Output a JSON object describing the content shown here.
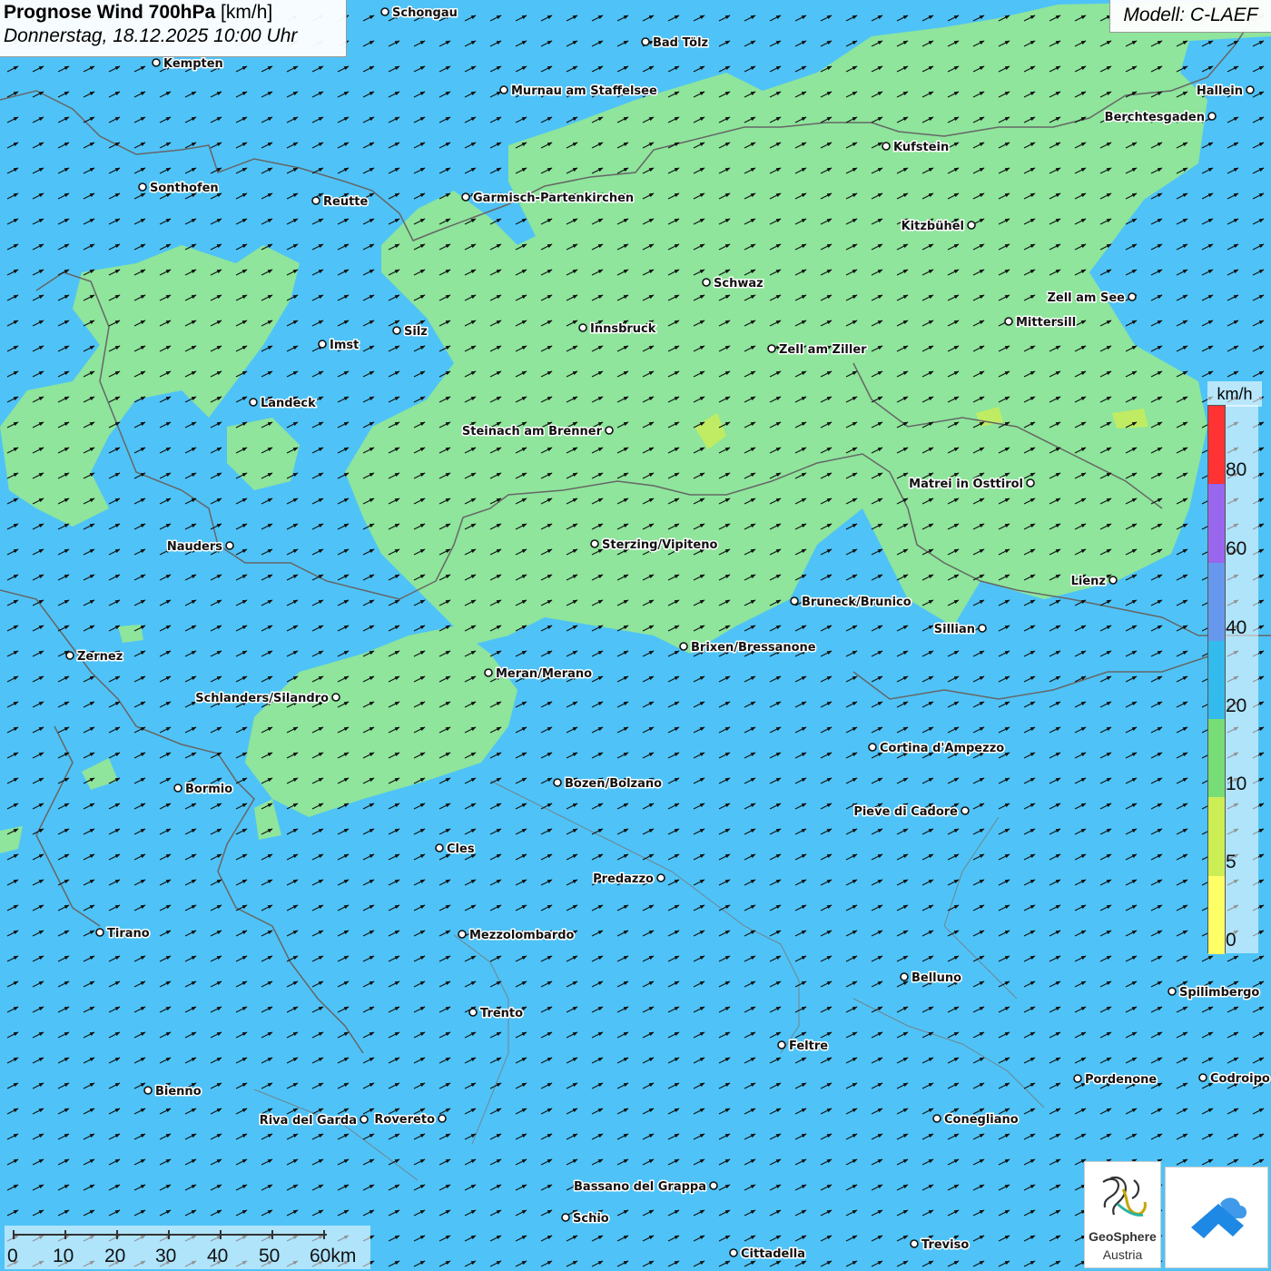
{
  "header": {
    "title_bold": "Prognose Wind 700hPa",
    "title_unit": "[km/h]",
    "datetime": "Donnerstag, 18.12.2025 10:00 Uhr"
  },
  "model_label": "Modell: C-LAEF",
  "legend": {
    "unit": "km/h",
    "labels": [
      "80",
      "60",
      "40",
      "20",
      "10",
      "5",
      "0"
    ],
    "colors": [
      "#ff3333",
      "#9966ee",
      "#6699ee",
      "#33bbee",
      "#77dd77",
      "#ccee55",
      "#ffff66"
    ]
  },
  "colors": {
    "water_blue": "#4fc3f7",
    "calm_green": "#8ee59b",
    "border_gray": "#666666"
  },
  "scalebar": {
    "labels": [
      "0",
      "10",
      "20",
      "30",
      "40",
      "50",
      "60km"
    ]
  },
  "logos": {
    "geosphere_line1": "GeoSphere",
    "geosphere_line2": "Austria"
  },
  "cities": [
    {
      "name": "Schongau"
    },
    {
      "name": "Bad Tölz"
    },
    {
      "name": "Kempten"
    },
    {
      "name": "Murnau am Staffelsee"
    },
    {
      "name": "Hallein"
    },
    {
      "name": "Berchtesgaden"
    },
    {
      "name": "Kufstein"
    },
    {
      "name": "Sonthofen"
    },
    {
      "name": "Reutte"
    },
    {
      "name": "Garmisch-Partenkirchen"
    },
    {
      "name": "Kitzbühel"
    },
    {
      "name": "Schwaz"
    },
    {
      "name": "Zell am See"
    },
    {
      "name": "Mittersill"
    },
    {
      "name": "Innsbruck"
    },
    {
      "name": "Silz"
    },
    {
      "name": "Imst"
    },
    {
      "name": "Zell am Ziller"
    },
    {
      "name": "Landeck"
    },
    {
      "name": "Steinach am Brenner"
    },
    {
      "name": "Matrei in Osttirol"
    },
    {
      "name": "Nauders"
    },
    {
      "name": "Sterzing/Vipiteno"
    },
    {
      "name": "Lienz"
    },
    {
      "name": "Bruneck/Brunico"
    },
    {
      "name": "Sillian"
    },
    {
      "name": "Zernez"
    },
    {
      "name": "Brixen/Bressanone"
    },
    {
      "name": "Meran/Merano"
    },
    {
      "name": "Schlanders/Silandro"
    },
    {
      "name": "Cortina d'Ampezzo"
    },
    {
      "name": "Bozen/Bolzano"
    },
    {
      "name": "Bormio"
    },
    {
      "name": "Pieve di Cadore"
    },
    {
      "name": "Cles"
    },
    {
      "name": "Predazzo"
    },
    {
      "name": "Tirano"
    },
    {
      "name": "Mezzolombardo"
    },
    {
      "name": "Belluno"
    },
    {
      "name": "Spilimbergo"
    },
    {
      "name": "Trento"
    },
    {
      "name": "Feltre"
    },
    {
      "name": "Bienno"
    },
    {
      "name": "Pordenone"
    },
    {
      "name": "Codroipo"
    },
    {
      "name": "Riva del Garda"
    },
    {
      "name": "Rovereto"
    },
    {
      "name": "Conegliano"
    },
    {
      "name": "Bassano del Grappa"
    },
    {
      "name": "Schio"
    },
    {
      "name": "Treviso"
    },
    {
      "name": "Cittadella"
    }
  ]
}
